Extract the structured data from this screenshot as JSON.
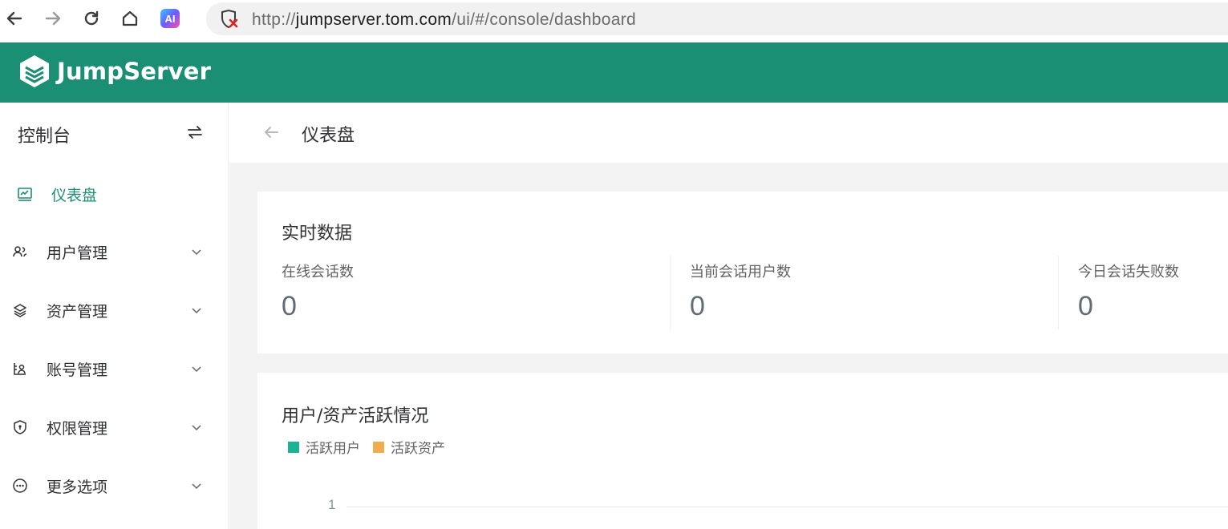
{
  "browser": {
    "url_prefix": "http://",
    "url_domain": "jumpserver.tom.com",
    "url_path": "/ui/#/console/dashboard",
    "ext_icon_text": "AI"
  },
  "app": {
    "name": "JumpServer",
    "brand_color": "#1a8f74"
  },
  "sidebar": {
    "title": "控制台",
    "items": [
      {
        "label": "仪表盘",
        "icon": "dashboard-icon",
        "active": true
      },
      {
        "label": "用户管理",
        "icon": "users-icon"
      },
      {
        "label": "资产管理",
        "icon": "layers-icon"
      },
      {
        "label": "账号管理",
        "icon": "account-icon"
      },
      {
        "label": "权限管理",
        "icon": "shield-icon"
      },
      {
        "label": "更多选项",
        "icon": "more-icon"
      }
    ]
  },
  "page": {
    "title": "仪表盘"
  },
  "realtime": {
    "title": "实时数据",
    "stats": [
      {
        "label": "在线会话数",
        "value": "0"
      },
      {
        "label": "当前会话用户数",
        "value": "0"
      },
      {
        "label": "今日会话失败数",
        "value": "0"
      }
    ]
  },
  "chart_data": {
    "type": "line",
    "title": "用户/资产活跃情况",
    "series": [
      {
        "name": "活跃用户",
        "color": "#1ab394",
        "values": []
      },
      {
        "name": "活跃资产",
        "color": "#f0ad4e",
        "values": []
      }
    ],
    "y_ticks": [
      "1"
    ]
  }
}
